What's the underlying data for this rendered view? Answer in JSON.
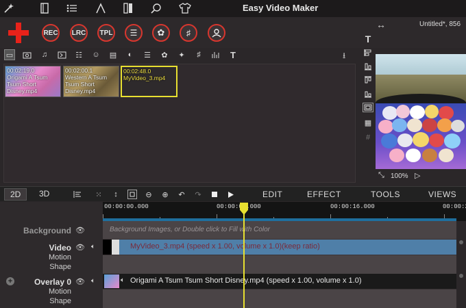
{
  "app": {
    "title": "Easy Video Maker",
    "project_title": "Untitled*, 856"
  },
  "titlebar_icons": [
    "wand-icon",
    "book-icon",
    "list-icon",
    "text-a-icon",
    "panels-icon",
    "search-icon",
    "tshirt-icon"
  ],
  "toolbar": {
    "rec": "REC",
    "lrc": "LRC",
    "tpl": "TPL"
  },
  "media": {
    "items": [
      {
        "time": "00:02:19.0",
        "name": "Origami  A Tsum Tsum Short  Disney.mp4"
      },
      {
        "time": "00:02:00.1",
        "name": "Western  A Tsum Tsum Short  Disney.mp4"
      },
      {
        "time": "00:02:48.0",
        "name": "MyVideo_3.mp4"
      }
    ]
  },
  "preview": {
    "zoom": "100%"
  },
  "editor": {
    "view_2d": "2D",
    "view_3d": "3D",
    "menu_edit": "EDIT",
    "menu_effect": "EFFECT",
    "menu_tools": "TOOLS",
    "menu_views": "VIEWS"
  },
  "ruler": {
    "labels": [
      "00:00:00.000",
      "00:00:08.000",
      "00:00:16.000",
      "00:00:2"
    ]
  },
  "tracks": {
    "background": {
      "name": "Background",
      "hint": "Background Images, or Double click to Fill with Color"
    },
    "video": {
      "name": "Video",
      "sub1": "Motion",
      "sub2": "Shape",
      "clip": "MyVideo_3.mp4  (speed x 1.00, volume x 1.0)(keep ratio)"
    },
    "overlay": {
      "name": "Overlay 0",
      "sub1": "Motion",
      "sub2": "Shape",
      "clip": "Origami  A Tsum Tsum Short  Disney.mp4  (speed x 1.00, volume x 1.0)"
    }
  },
  "colors": {
    "accent_red": "#d9362e",
    "playhead_yellow": "#e8e030",
    "ruler_blue": "#1f6f9e",
    "selected_clip": "#4f7fa8"
  }
}
